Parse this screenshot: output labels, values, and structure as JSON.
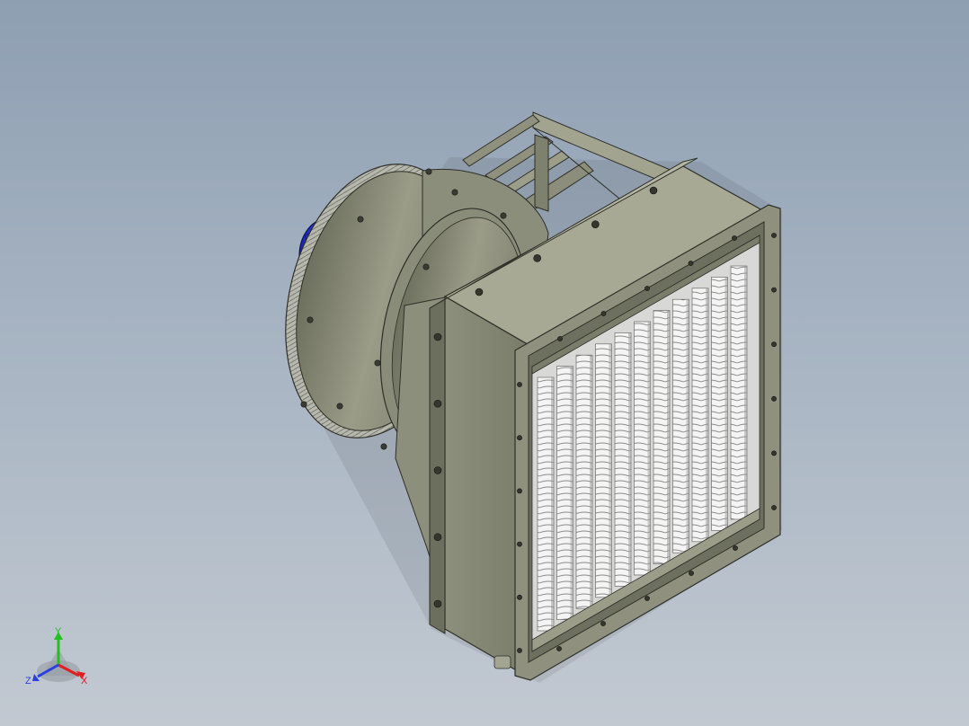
{
  "viewport": {
    "background_top": "#8e9fb2",
    "background_bottom": "#c2c9d1"
  },
  "model": {
    "name": "fan-heater-with-finned-coil",
    "housing_color": "#8a8c7a",
    "motor_color": "#2a37d6",
    "fin_color": "#f2f2f2"
  },
  "triad": {
    "x_label": "X",
    "y_label": "Y",
    "z_label": "Z",
    "x_color": "#e02020",
    "y_color": "#22c022",
    "z_color": "#2a3fe0"
  }
}
